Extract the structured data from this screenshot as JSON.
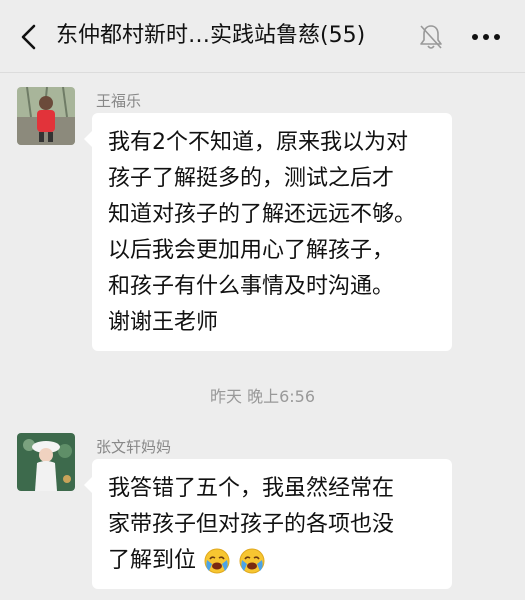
{
  "header": {
    "title": "东仲都村新时…实践站鲁慈(55)"
  },
  "messages": [
    {
      "sender": "王福乐",
      "lines": [
        "我有2个不知道，原来我以为对",
        "孩子了解挺多的，测试之后才",
        "知道对孩子的了解还远远不够。",
        "以后我会更加用心了解孩子，",
        "和孩子有什么事情及时沟通。",
        "谢谢王老师"
      ]
    },
    {
      "sender": "张文轩妈妈",
      "lines": [
        "我答错了五个，我虽然经常在",
        "家带孩子但对孩子的各项也没",
        "了解到位"
      ],
      "emojis": [
        "loudly-crying-face",
        "loudly-crying-face"
      ]
    }
  ],
  "timestamp": "昨天 晚上6:56",
  "colors": {
    "background": "#ededed",
    "bubble": "#ffffff",
    "text": "#111111",
    "meta": "#888888"
  }
}
